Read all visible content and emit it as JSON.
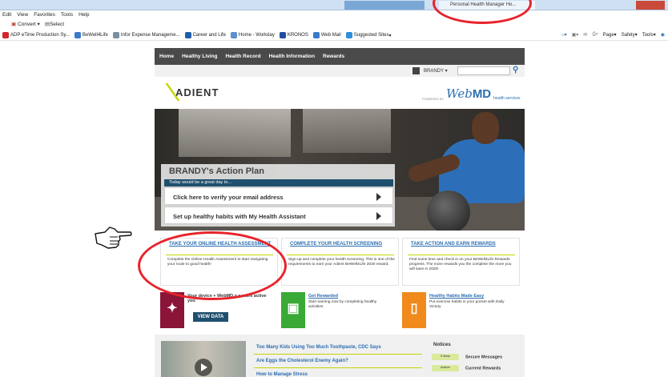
{
  "browser": {
    "active_tab_title": "Personal Health Manager Ho...",
    "menu": [
      "Edit",
      "View",
      "Favorites",
      "Tools",
      "Help"
    ],
    "commands": [
      "Convert",
      "Select"
    ],
    "favorites": [
      {
        "label": "ADP eTime Production Sy...",
        "color": "#d0282e"
      },
      {
        "label": "BeWell4Life",
        "color": "#3a7bc8"
      },
      {
        "label": "Infor Expense Manageme...",
        "color": "#7a8f9e"
      },
      {
        "label": "Career and Life",
        "color": "#1f5fa8"
      },
      {
        "label": "Home - Workday",
        "color": "#5a8fd0"
      },
      {
        "label": "KRONOS",
        "color": "#1f4f9e"
      },
      {
        "label": "Web Mail",
        "color": "#3a7bc8"
      },
      {
        "label": "Suggested Sites",
        "color": "#2e8fd8"
      }
    ],
    "toolbar_right": [
      "Page",
      "Safety",
      "Tools"
    ]
  },
  "site": {
    "nav": [
      "Home",
      "Healthy Living",
      "Health Record",
      "Health Information",
      "Rewards"
    ],
    "user_name": "BRANDY",
    "brand": "ADIENT",
    "partner": {
      "powered_by": "POWERED BY",
      "web": "Web",
      "md": "MD",
      "health_services": "health services"
    },
    "action_plan": {
      "title": "BRANDY's Action Plan",
      "subtitle": "Today would be a great day to...",
      "items": [
        "Click here to verify your email address",
        "Set up healthy habits with My Health Assistant"
      ]
    },
    "cards": [
      {
        "title": "TAKE YOUR ONLINE HEALTH ASSESSMENT",
        "body": "Complete the Online Health Assessment to start navigating your route to good health!"
      },
      {
        "title": "COMPLETE YOUR HEALTH SCREENING",
        "body": "Sign-up and complete your health screening. This is one of the requirements to earn your Adient BeWell4Life 2020 reward."
      },
      {
        "title": "TAKE ACTION AND EARN REWARDS",
        "body": "Find some time and check in on your BeWell4Life Rewards progress. The more rewards you the complete the more you will save in 2020!"
      }
    ],
    "features": [
      {
        "title": "Your device + WebMD = a more active you",
        "button": "VIEW DATA",
        "color": "#8a1538"
      },
      {
        "title": "Get Rewarded",
        "body": "Start earning now by completing healthy activities",
        "color": "#3aa935"
      },
      {
        "title": "Healthy Habits Made Easy",
        "body": "Put exercise habits in your pocket with Daily Victory",
        "color": "#f08a1c"
      }
    ],
    "stories": [
      "Too Many Kids Using Too Much Toothpaste, CDC Says",
      "Are Eggs the Cholesterol Enemy Again?",
      "How to Manage Stress"
    ],
    "notices": {
      "title": "Notices",
      "items": [
        {
          "pill": "0 New",
          "label": "Secure Messages"
        },
        {
          "pill": "Active",
          "label": "Current Rewards"
        }
      ]
    }
  }
}
